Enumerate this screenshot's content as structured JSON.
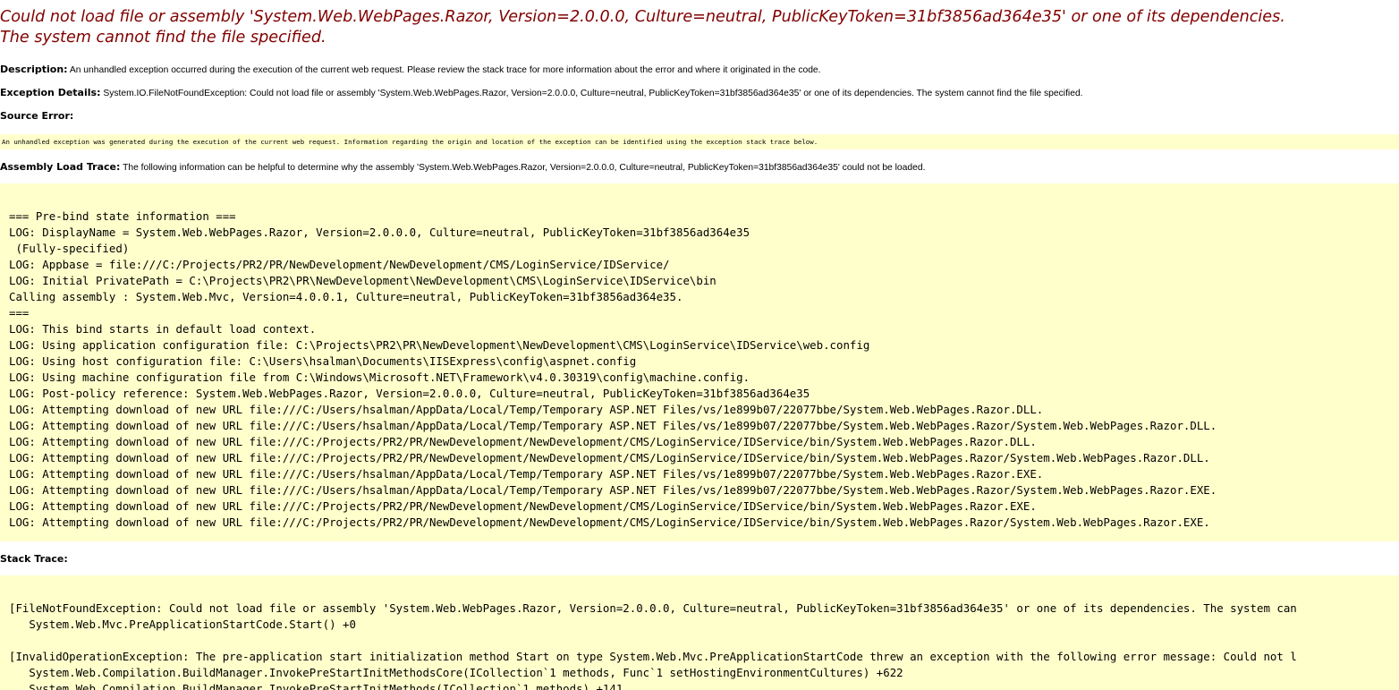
{
  "error_title": {
    "line1": "Could not load file or assembly 'System.Web.WebPages.Razor, Version=2.0.0.0, Culture=neutral, PublicKeyToken=31bf3856ad364e35' or one of its dependencies.",
    "line2": "The system cannot find the file specified."
  },
  "description": {
    "label": "Description:",
    "text": " An unhandled exception occurred during the execution of the current web request. Please review the stack trace for more information about the error and where it originated in the code."
  },
  "exception_details": {
    "label": "Exception Details:",
    "text": " System.IO.FileNotFoundException: Could not load file or assembly 'System.Web.WebPages.Razor, Version=2.0.0.0, Culture=neutral, PublicKeyToken=31bf3856ad364e35' or one of its dependencies. The system cannot find the file specified."
  },
  "source_error": {
    "label": "Source Error:",
    "text": "An unhandled exception was generated during the execution of the current web request. Information regarding the origin and location of the exception can be identified using the exception stack trace below."
  },
  "assembly_load_trace": {
    "label": "Assembly Load Trace:",
    "text": " The following information can be helpful to determine why the assembly 'System.Web.WebPages.Razor, Version=2.0.0.0, Culture=neutral, PublicKeyToken=31bf3856ad364e35' could not be loaded.",
    "log": "=== Pre-bind state information ===\nLOG: DisplayName = System.Web.WebPages.Razor, Version=2.0.0.0, Culture=neutral, PublicKeyToken=31bf3856ad364e35\n (Fully-specified)\nLOG: Appbase = file:///C:/Projects/PR2/PR/NewDevelopment/NewDevelopment/CMS/LoginService/IDService/\nLOG: Initial PrivatePath = C:\\Projects\\PR2\\PR\\NewDevelopment\\NewDevelopment\\CMS\\LoginService\\IDService\\bin\nCalling assembly : System.Web.Mvc, Version=4.0.0.1, Culture=neutral, PublicKeyToken=31bf3856ad364e35.\n===\nLOG: This bind starts in default load context.\nLOG: Using application configuration file: C:\\Projects\\PR2\\PR\\NewDevelopment\\NewDevelopment\\CMS\\LoginService\\IDService\\web.config\nLOG: Using host configuration file: C:\\Users\\hsalman\\Documents\\IISExpress\\config\\aspnet.config\nLOG: Using machine configuration file from C:\\Windows\\Microsoft.NET\\Framework\\v4.0.30319\\config\\machine.config.\nLOG: Post-policy reference: System.Web.WebPages.Razor, Version=2.0.0.0, Culture=neutral, PublicKeyToken=31bf3856ad364e35\nLOG: Attempting download of new URL file:///C:/Users/hsalman/AppData/Local/Temp/Temporary ASP.NET Files/vs/1e899b07/22077bbe/System.Web.WebPages.Razor.DLL.\nLOG: Attempting download of new URL file:///C:/Users/hsalman/AppData/Local/Temp/Temporary ASP.NET Files/vs/1e899b07/22077bbe/System.Web.WebPages.Razor/System.Web.WebPages.Razor.DLL.\nLOG: Attempting download of new URL file:///C:/Projects/PR2/PR/NewDevelopment/NewDevelopment/CMS/LoginService/IDService/bin/System.Web.WebPages.Razor.DLL.\nLOG: Attempting download of new URL file:///C:/Projects/PR2/PR/NewDevelopment/NewDevelopment/CMS/LoginService/IDService/bin/System.Web.WebPages.Razor/System.Web.WebPages.Razor.DLL.\nLOG: Attempting download of new URL file:///C:/Users/hsalman/AppData/Local/Temp/Temporary ASP.NET Files/vs/1e899b07/22077bbe/System.Web.WebPages.Razor.EXE.\nLOG: Attempting download of new URL file:///C:/Users/hsalman/AppData/Local/Temp/Temporary ASP.NET Files/vs/1e899b07/22077bbe/System.Web.WebPages.Razor/System.Web.WebPages.Razor.EXE.\nLOG: Attempting download of new URL file:///C:/Projects/PR2/PR/NewDevelopment/NewDevelopment/CMS/LoginService/IDService/bin/System.Web.WebPages.Razor.EXE.\nLOG: Attempting download of new URL file:///C:/Projects/PR2/PR/NewDevelopment/NewDevelopment/CMS/LoginService/IDService/bin/System.Web.WebPages.Razor/System.Web.WebPages.Razor.EXE."
  },
  "stack_trace": {
    "label": "Stack Trace:",
    "text": "[FileNotFoundException: Could not load file or assembly 'System.Web.WebPages.Razor, Version=2.0.0.0, Culture=neutral, PublicKeyToken=31bf3856ad364e35' or one of its dependencies. The system can\n   System.Web.Mvc.PreApplicationStartCode.Start() +0\n\n[InvalidOperationException: The pre-application start initialization method Start on type System.Web.Mvc.PreApplicationStartCode threw an exception with the following error message: Could not l\n   System.Web.Compilation.BuildManager.InvokePreStartInitMethodsCore(ICollection`1 methods, Func`1 setHostingEnvironmentCultures) +622\n   System.Web.Compilation.BuildManager.InvokePreStartInitMethods(ICollection`1 methods) +141"
  }
}
